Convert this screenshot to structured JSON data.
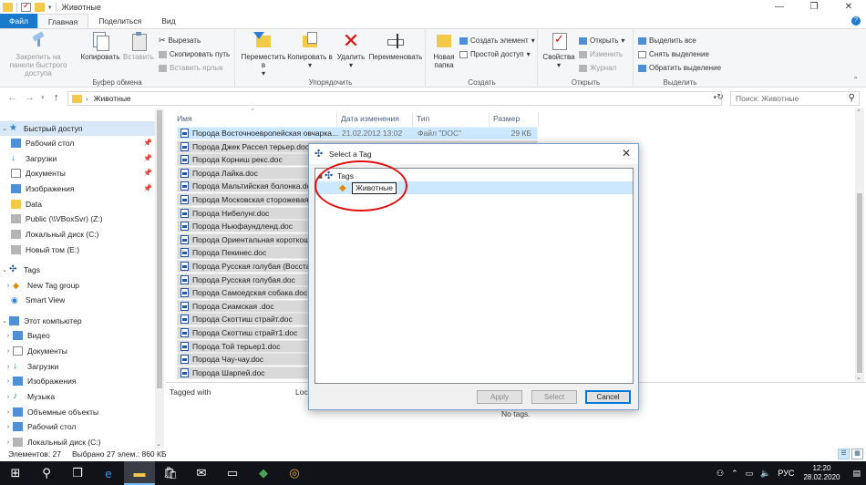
{
  "window": {
    "title": "Животные",
    "min_icon": "minimize-icon",
    "max_icon": "maximize-icon",
    "close_icon": "close-icon"
  },
  "ribbon_tabs": [
    "Файл",
    "Главная",
    "Поделиться",
    "Вид"
  ],
  "ribbon": {
    "groups": {
      "clipboard": "Буфер обмена",
      "organize": "Упорядочить",
      "create": "Создать",
      "open": "Открыть",
      "select": "Выделить"
    },
    "pin": "Закрепить на панели быстрого доступа",
    "copy": "Копировать",
    "paste": "Вставить",
    "cut": "Вырезать",
    "copy_path": "Скопировать путь",
    "paste_shortcut": "Вставить ярлык",
    "move_to": "Переместить в",
    "copy_to": "Копировать в",
    "delete": "Удалить",
    "rename": "Переименовать",
    "new_folder": "Новая папка",
    "new_item": "Создать элемент",
    "easy_access": "Простой доступ",
    "properties": "Свойства",
    "open": "Открыть",
    "edit": "Изменить",
    "history": "Журнал",
    "select_all": "Выделить все",
    "select_none": "Снять выделение",
    "invert_selection": "Обратить выделение"
  },
  "address": {
    "path": "Животные",
    "search_placeholder": "Поиск: Животные"
  },
  "nav": {
    "quick_access": "Быстрый доступ",
    "items": [
      {
        "label": "Рабочий стол",
        "pinned": true
      },
      {
        "label": "Загрузки",
        "pinned": true
      },
      {
        "label": "Документы",
        "pinned": true
      },
      {
        "label": "Изображения",
        "pinned": true
      },
      {
        "label": "Data",
        "pinned": false
      },
      {
        "label": "Public (\\\\VBoxSvr) (Z:)",
        "pinned": false
      },
      {
        "label": "Локальный диск (C:)",
        "pinned": false
      },
      {
        "label": "Новый том (E:)",
        "pinned": false
      }
    ],
    "tags": "Tags",
    "tag_items": [
      "New Tag group",
      "Smart View"
    ],
    "this_pc": "Этот компьютер",
    "pc_items": [
      "Видео",
      "Документы",
      "Загрузки",
      "Изображения",
      "Музыка",
      "Объемные объекты",
      "Рабочий стол",
      "Локальный диск (C:)"
    ]
  },
  "columns": {
    "name": "Имя",
    "date": "Дата изменения",
    "type": "Тип",
    "size": "Размер"
  },
  "files": [
    {
      "name": "Порода Восточноевропейская овчарка...",
      "date": "21.02.2012 13:02",
      "type": "Файл \"DOC\"",
      "size": "29 КБ"
    },
    {
      "name": "Порода Джек Рассел терьер.doc",
      "date": "",
      "type": "",
      "size": ""
    },
    {
      "name": "Порода Корниш рекс.doc",
      "date": "",
      "type": "",
      "size": ""
    },
    {
      "name": "Порода Лайка.doc",
      "date": "",
      "type": "",
      "size": ""
    },
    {
      "name": "Порода Мальтийская болонка.doc",
      "date": "",
      "type": "",
      "size": ""
    },
    {
      "name": "Порода Московская сторожевая.d...",
      "date": "",
      "type": "",
      "size": ""
    },
    {
      "name": "Порода Нибелунг.doc",
      "date": "",
      "type": "",
      "size": ""
    },
    {
      "name": "Порода Ньюфаундленд.doc",
      "date": "",
      "type": "",
      "size": ""
    },
    {
      "name": "Порода Ориентальная короткош...",
      "date": "",
      "type": "",
      "size": ""
    },
    {
      "name": "Порода Пекинес.doc",
      "date": "",
      "type": "",
      "size": ""
    },
    {
      "name": "Порода Русская голубая (Восстан...",
      "date": "",
      "type": "",
      "size": ""
    },
    {
      "name": "Порода Русская голубая.doc",
      "date": "",
      "type": "",
      "size": ""
    },
    {
      "name": "Порода Самоедская собака.doc",
      "date": "",
      "type": "",
      "size": ""
    },
    {
      "name": "Порода Сиамская .doc",
      "date": "",
      "type": "",
      "size": ""
    },
    {
      "name": "Порода Скоттиш страйт.doc",
      "date": "",
      "type": "",
      "size": ""
    },
    {
      "name": "Порода Скоттиш страйт1.doc",
      "date": "",
      "type": "",
      "size": ""
    },
    {
      "name": "Порода Той терьер1.doc",
      "date": "",
      "type": "",
      "size": ""
    },
    {
      "name": "Порода Чау-чау.doc",
      "date": "",
      "type": "",
      "size": ""
    },
    {
      "name": "Порода Шарпей.doc",
      "date": "",
      "type": "",
      "size": ""
    }
  ],
  "tag_panel": {
    "tagged_with": "Tagged with",
    "loc": "Loc",
    "no_tags": "No tags."
  },
  "status": {
    "count": "Элементов: 27",
    "selected": "Выбрано 27 элем.: 860 КБ"
  },
  "dialog": {
    "title": "Select a Tag",
    "root": "Tags",
    "editing": "Животные",
    "apply": "Apply",
    "select": "Select",
    "cancel": "Cancel"
  },
  "taskbar": {
    "lang": "РУС",
    "time": "12:20",
    "date": "28.02.2020"
  },
  "colors": {
    "accent": "#1979ca",
    "selection": "#cce8ff",
    "highlight_circle": "#e01010"
  }
}
